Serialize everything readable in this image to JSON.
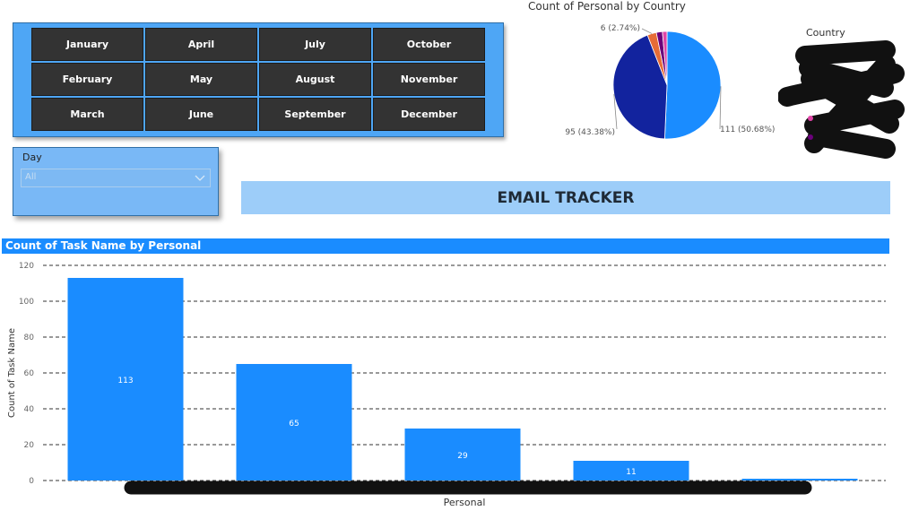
{
  "month_slicer": {
    "months": [
      "January",
      "April",
      "July",
      "October",
      "February",
      "May",
      "August",
      "November",
      "March",
      "June",
      "September",
      "December"
    ]
  },
  "day_slicer": {
    "label": "Day",
    "value": "All"
  },
  "banner": {
    "title": "EMAIL TRACKER"
  },
  "colors": {
    "accent": "#1a8cff",
    "pie_series": [
      "#1a8cff",
      "#12239e",
      "#e66c37",
      "#6b007b",
      "#e044a7"
    ]
  },
  "chart_data": [
    {
      "type": "pie",
      "title": "Count of Personal by Country",
      "legend_title": "Country",
      "legend_position": "right",
      "slices": [
        {
          "value": 111,
          "label": "111 (50.68%)"
        },
        {
          "value": 95,
          "label": "95 (43.38%)"
        },
        {
          "value": 6,
          "label": "6 (2.74%)"
        },
        {
          "value": 4,
          "label": ""
        },
        {
          "value": 3,
          "label": ""
        }
      ]
    },
    {
      "type": "bar",
      "title": "Count of Task Name by Personal",
      "xlabel": "Personal",
      "ylabel": "Count of Task Name",
      "ylim": [
        0,
        120
      ],
      "yticks": [
        0,
        20,
        40,
        60,
        80,
        100,
        120
      ],
      "grid": true,
      "values": [
        113,
        65,
        29,
        11,
        1
      ],
      "data_labels": [
        "113",
        "65",
        "29",
        "11",
        ""
      ]
    }
  ]
}
